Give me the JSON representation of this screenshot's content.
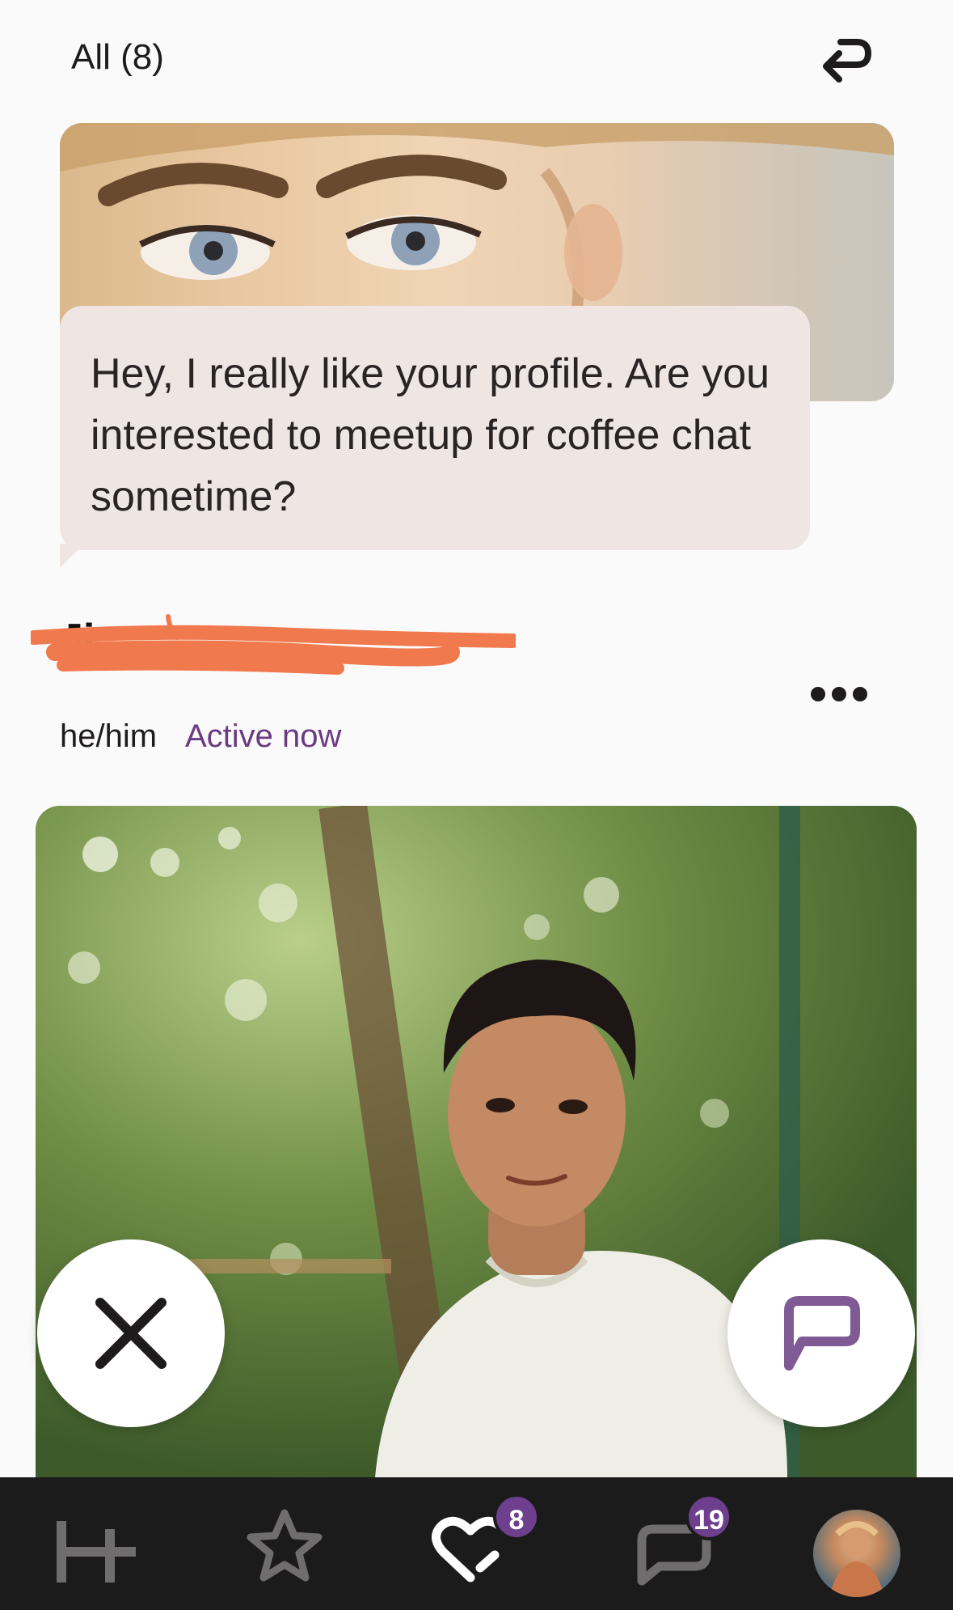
{
  "header": {
    "filter_label": "All (8)",
    "undo_icon": "undo-arrow-icon"
  },
  "like_card": {
    "message": "Hey, I really like your profile. Are you interested to meetup for coffee chat sometime?"
  },
  "profile": {
    "name": "Ji        ",
    "pronouns": "he/him",
    "status": "Active now",
    "more_icon": "more-dots-icon"
  },
  "actions": {
    "skip_icon": "close-x-icon",
    "comment_icon": "chat-bubble-icon"
  },
  "tabbar": {
    "items": [
      {
        "icon": "home-h-icon"
      },
      {
        "icon": "star-icon"
      },
      {
        "icon": "likes-heart-icon",
        "badge": "8"
      },
      {
        "icon": "messages-icon",
        "badge": "19"
      },
      {
        "icon": "profile-avatar"
      }
    ]
  },
  "colors": {
    "accent": "#6d3f8c",
    "status": "#6b3b82",
    "bubble": "#efe6e4",
    "tabbar": "#1c1b1c",
    "redaction": "#f07a4e"
  }
}
